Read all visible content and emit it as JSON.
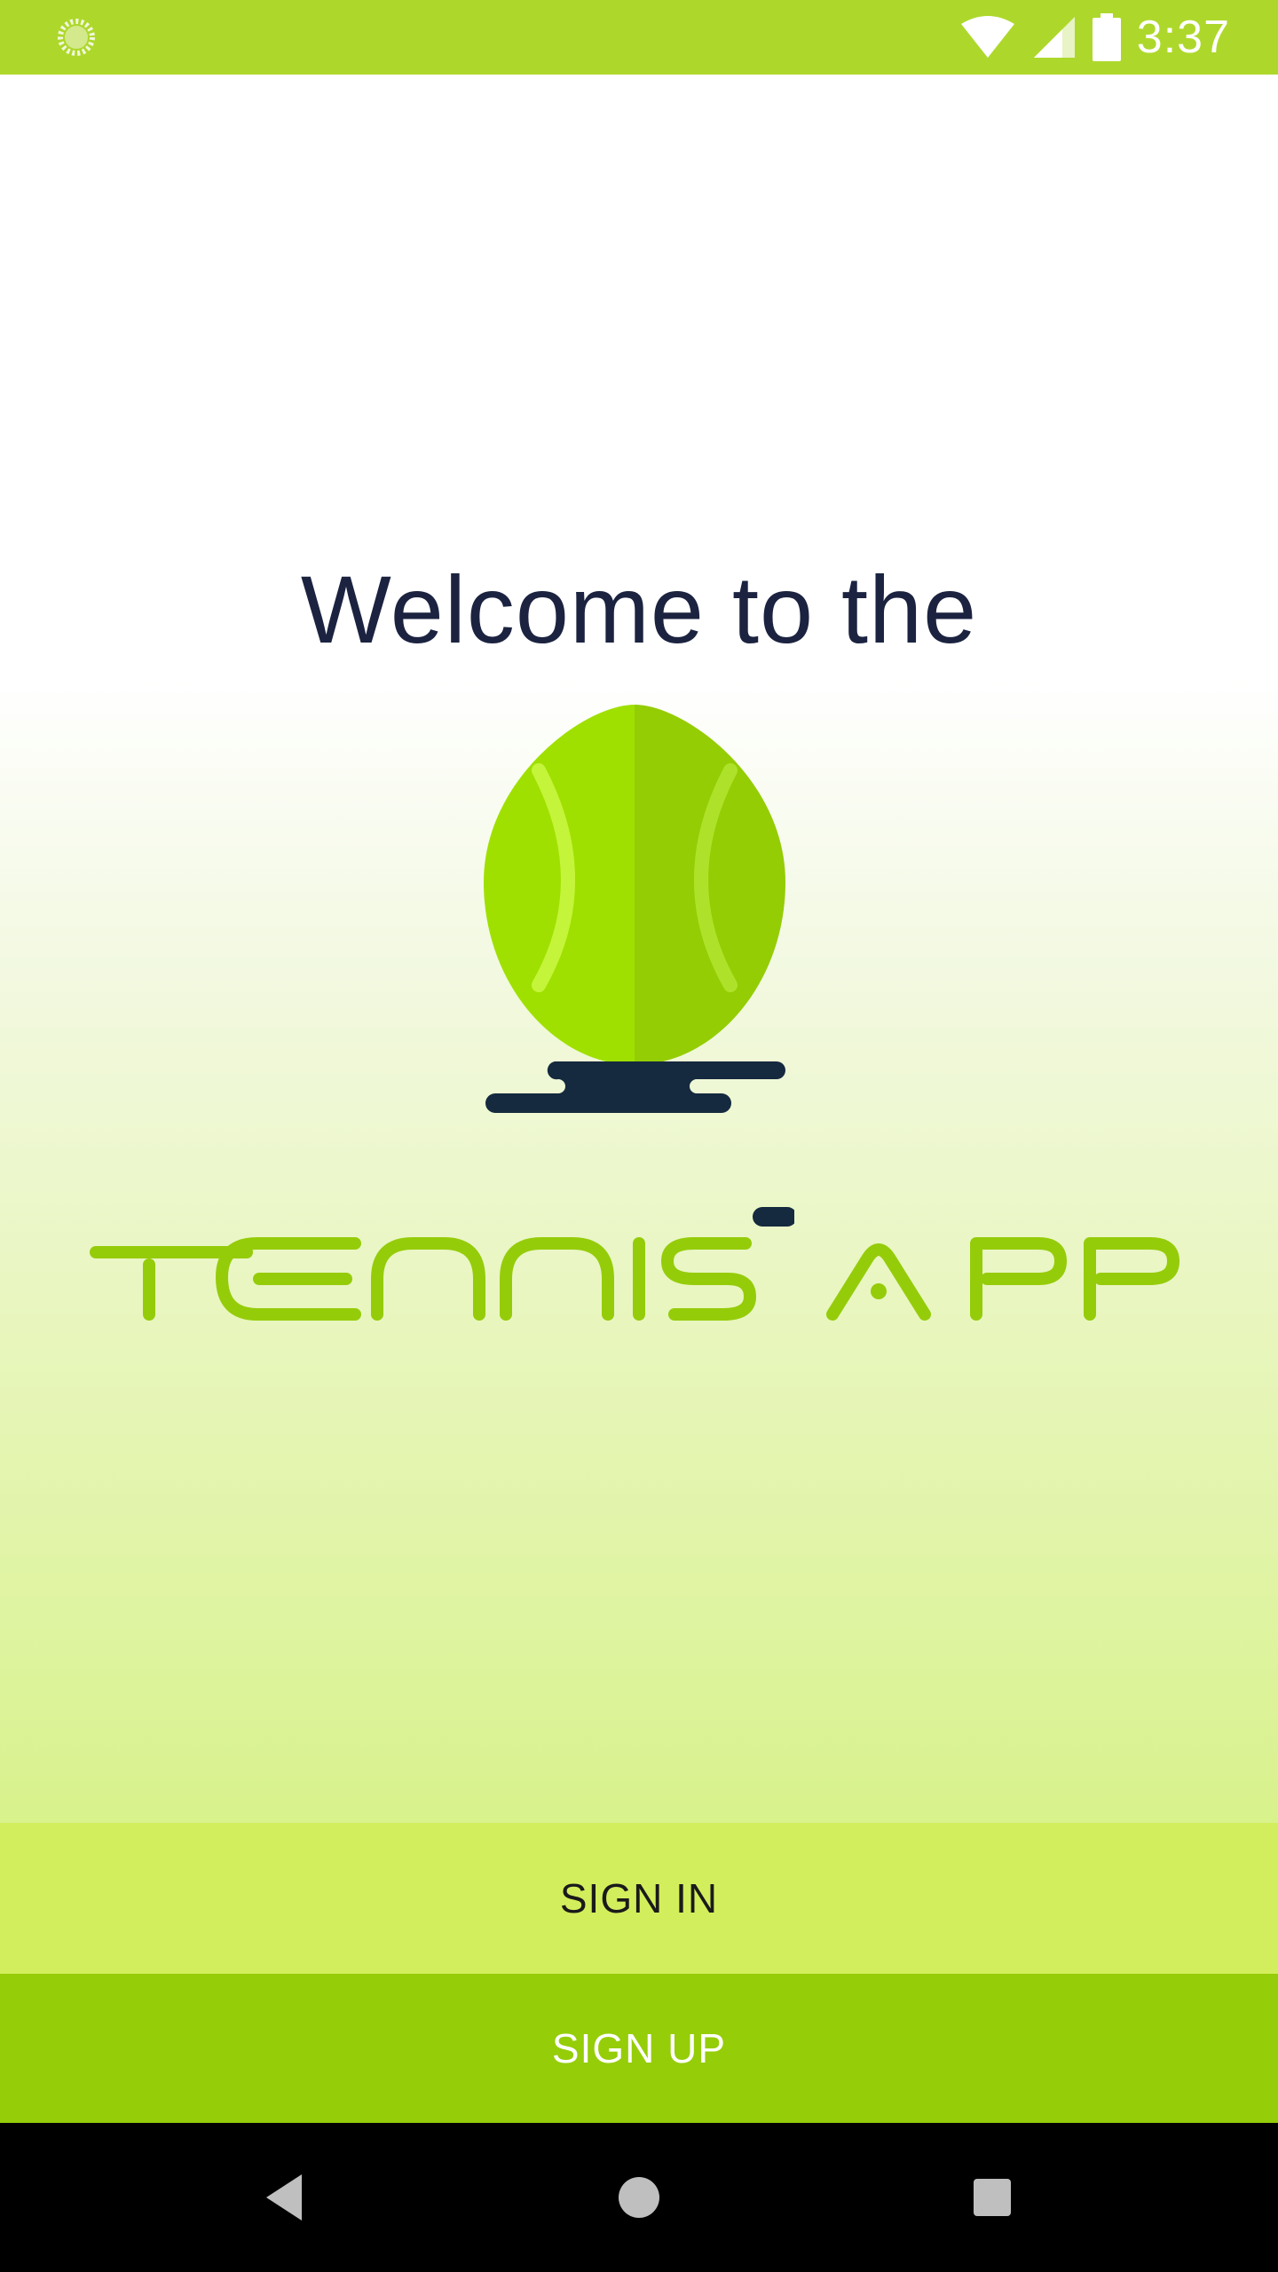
{
  "status_bar": {
    "time": "3:37",
    "left_icon": "loading-spinner-icon",
    "right_icons": [
      "wifi-icon",
      "signal-icon",
      "battery-icon"
    ]
  },
  "welcome": {
    "title": "Welcome to the"
  },
  "logo": {
    "wordmark": "TENNIS APP",
    "icon": "tennis-ball-icon"
  },
  "actions": {
    "sign_in": "SIGN IN",
    "sign_up": "SIGN UP"
  },
  "nav_bar": {
    "icons": [
      "back-icon",
      "home-icon",
      "recents-icon"
    ]
  },
  "colors": {
    "status_bar": "#add82b",
    "sign_in_bg": "#d3ee5c",
    "sign_up_bg": "#95cd09",
    "title_text": "#1b2340",
    "logo_green": "#95cc0a",
    "logo_shadow": "#152a3f"
  }
}
